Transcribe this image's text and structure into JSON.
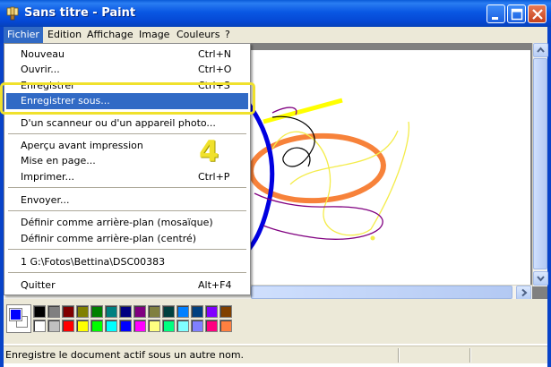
{
  "window": {
    "title": "Sans titre - Paint",
    "icon": "paint-brush-icon",
    "buttons": [
      "minimize-icon",
      "maximize-icon",
      "close-icon"
    ]
  },
  "menubar": {
    "items": [
      "Fichier",
      "Edition",
      "Affichage",
      "Image",
      "Couleurs",
      "?"
    ],
    "active": "Fichier"
  },
  "file_menu": {
    "items": [
      {
        "label": "Nouveau",
        "shortcut": "Ctrl+N"
      },
      {
        "label": "Ouvrir...",
        "shortcut": "Ctrl+O"
      },
      {
        "label": "Enregistrer",
        "shortcut": "Ctrl+S"
      },
      {
        "label": "Enregistrer sous...",
        "shortcut": ""
      },
      {
        "label": "D'un scanneur ou d'un appareil photo...",
        "shortcut": ""
      },
      {
        "label": "Aperçu avant impression",
        "shortcut": ""
      },
      {
        "label": "Mise en page...",
        "shortcut": ""
      },
      {
        "label": "Imprimer...",
        "shortcut": "Ctrl+P"
      },
      {
        "label": "Envoyer...",
        "shortcut": ""
      },
      {
        "label": "Définir comme arrière-plan (mosaïque)",
        "shortcut": ""
      },
      {
        "label": "Définir comme arrière-plan (centré)",
        "shortcut": ""
      },
      {
        "label": "1 G:\\Fotos\\Bettina\\DSC00383",
        "shortcut": ""
      },
      {
        "label": "Quitter",
        "shortcut": "Alt+F4"
      }
    ],
    "highlighted": "Enregistrer sous..."
  },
  "annotation": {
    "step_number": "4",
    "highlight_color": "#f0e12c"
  },
  "palette": {
    "foreground": "#0000ff",
    "background": "#ffffff",
    "colors_top": [
      "#000000",
      "#808080",
      "#800000",
      "#808000",
      "#008000",
      "#008080",
      "#000080",
      "#800080",
      "#808040",
      "#004040",
      "#0080ff",
      "#004080",
      "#8000ff",
      "#804000"
    ],
    "colors_bottom": [
      "#ffffff",
      "#c0c0c0",
      "#ff0000",
      "#ffff00",
      "#00ff00",
      "#00ffff",
      "#0000ff",
      "#ff00ff",
      "#ffff80",
      "#00ff80",
      "#80ffff",
      "#8080ff",
      "#ff0080",
      "#ff8040"
    ]
  },
  "statusbar": {
    "text": "Enregistre le document actif sous un autre nom."
  }
}
